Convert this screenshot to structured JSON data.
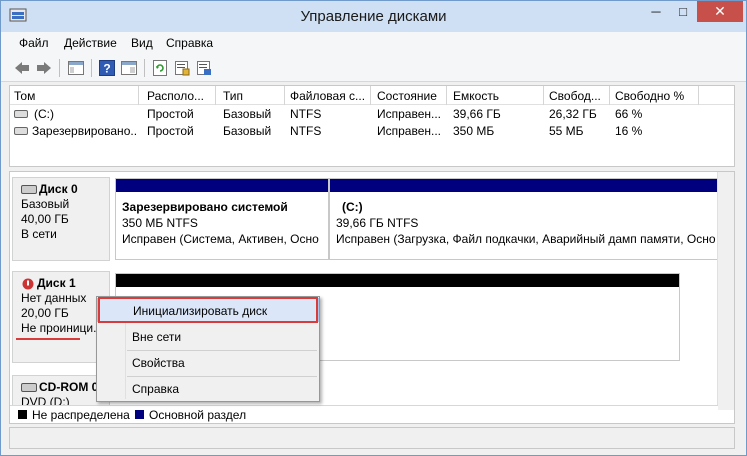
{
  "window": {
    "title": "Управление дисками",
    "min_glyph": "─",
    "max_glyph": "□",
    "close_glyph": "✕"
  },
  "menu": [
    "Файл",
    "Действие",
    "Вид",
    "Справка"
  ],
  "toolbar": {
    "icons": [
      "back-arrow-icon",
      "forward-arrow-icon",
      "console-tree-icon",
      "help-icon",
      "show-hide-icon",
      "refresh-icon",
      "properties-icon",
      "export-icon"
    ]
  },
  "volumes": {
    "columns": [
      "Том",
      "Располо...",
      "Тип",
      "Файловая с...",
      "Состояние",
      "Емкость",
      "Свобод...",
      "Свободно %"
    ],
    "rows": [
      [
        "(C:)",
        "Простой",
        "Базовый",
        "NTFS",
        "Исправен...",
        "39,66 ГБ",
        "26,32 ГБ",
        "66 %"
      ],
      [
        "Зарезервировано...",
        "Простой",
        "Базовый",
        "NTFS",
        "Исправен...",
        "350 МБ",
        "55 МБ",
        "16 %"
      ]
    ]
  },
  "disks": {
    "disk0": {
      "name": "Диск 0",
      "type": "Базовый",
      "size": "40,00 ГБ",
      "status": "В сети",
      "partitions": [
        {
          "title": "Зарезервировано системой",
          "size": "350 МБ NTFS",
          "status": "Исправен (Система, Активен, Осно"
        },
        {
          "title": "(C:)",
          "size": "39,66 ГБ NTFS",
          "status": "Исправен (Загрузка, Файл подкачки, Аварийный дамп памяти, Осно"
        }
      ]
    },
    "disk1": {
      "name": "Диск 1",
      "type": "Нет данных",
      "size": "20,00 ГБ",
      "status": "Не проиници..."
    },
    "cdrom": {
      "name": "CD-ROM 0",
      "type": "DVD (D:)"
    }
  },
  "legend": [
    {
      "label": "Не распределена",
      "color": "#000000"
    },
    {
      "label": "Основной раздел",
      "color": "#00007f"
    }
  ],
  "context_menu": {
    "items": [
      "Инициализировать диск",
      "Вне сети",
      "Свойства",
      "Справка"
    ]
  },
  "colors": {
    "primary_partition": "#00007f",
    "unallocated": "#000000",
    "highlight": "#d93a3a"
  }
}
